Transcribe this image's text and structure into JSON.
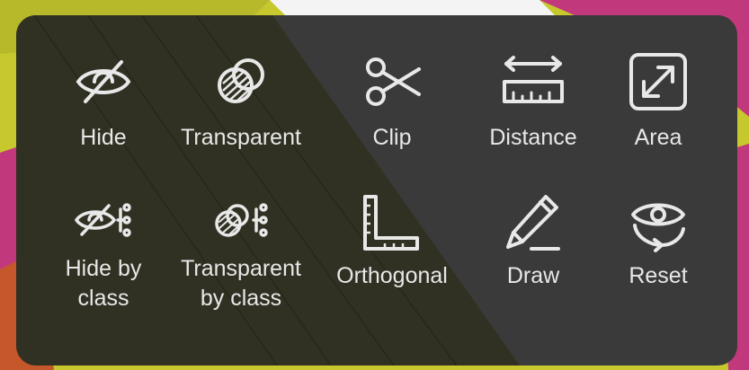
{
  "toolbar": {
    "row1": [
      {
        "label": "Hide",
        "icon": "eye-off-icon"
      },
      {
        "label": "Transparent",
        "icon": "transparent-spheres-icon"
      },
      {
        "label": "Clip",
        "icon": "scissors-icon"
      },
      {
        "label": "Distance",
        "icon": "ruler-icon"
      },
      {
        "label": "Area",
        "icon": "expand-arrows-icon"
      }
    ],
    "row2": [
      {
        "label": "Hide by\nclass",
        "icon": "eye-off-class-icon"
      },
      {
        "label": "Transparent\nby class",
        "icon": "transparent-class-icon"
      },
      {
        "label": "Orthogonal",
        "icon": "square-ruler-icon"
      },
      {
        "label": "Draw",
        "icon": "pencil-icon"
      },
      {
        "label": "Reset",
        "icon": "eye-reset-icon"
      }
    ]
  },
  "colors": {
    "panel": "#3a3a3a",
    "panel_tint": "#2f2f1c",
    "icon": "#e8e8e8",
    "backdrop_yellow": "#c7c82e",
    "backdrop_magenta": "#c2387c",
    "backdrop_orange": "#c5572a"
  }
}
